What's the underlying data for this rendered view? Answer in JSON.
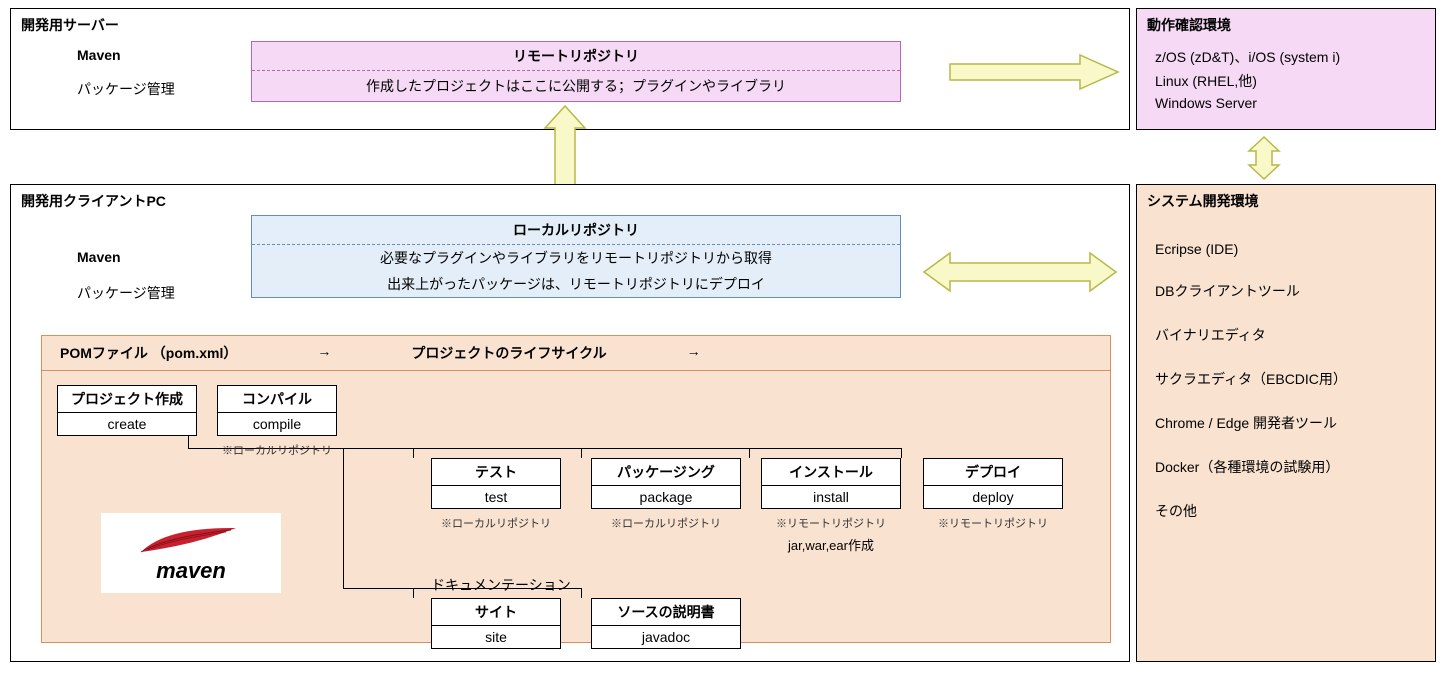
{
  "server": {
    "title": "開発用サーバー",
    "maven_label": "Maven",
    "pkg_label": "パッケージ管理",
    "remote_repo": {
      "title": "リモートリポジトリ",
      "desc": "作成したプロジェクトはここに公開する；プラグインやライブラリ"
    }
  },
  "runtime_env": {
    "title": "動作確認環境",
    "items": [
      "z/OS (zD&T)、i/OS (system i)",
      "Linux (RHEL,他)",
      "Windows Server"
    ]
  },
  "client": {
    "title": "開発用クライアントPC",
    "maven_label": "Maven",
    "pkg_label": "パッケージ管理",
    "local_repo": {
      "title": "ローカルリポジトリ",
      "desc1": "必要なプラグインやライブラリをリモートリポジトリから取得",
      "desc2": "出来上がったパッケージは、リモートリポジトリにデプロイ"
    },
    "pom": {
      "header_left": "POMファイル （pom.xml）",
      "header_arrow1": "→",
      "header_center": "プロジェクトのライフサイクル",
      "header_arrow2": "→"
    },
    "phases": {
      "create": {
        "title": "プロジェクト作成",
        "cmd": "create",
        "note": ""
      },
      "compile": {
        "title": "コンパイル",
        "cmd": "compile",
        "note": "※ローカルリポジトリ"
      },
      "test": {
        "title": "テスト",
        "cmd": "test",
        "note": "※ローカルリポジトリ"
      },
      "package": {
        "title": "パッケージング",
        "cmd": "package",
        "note": "※ローカルリポジトリ"
      },
      "install": {
        "title": "インストール",
        "cmd": "install",
        "note": "※リモートリポジトリ",
        "extra": "jar,war,ear作成"
      },
      "deploy": {
        "title": "デプロイ",
        "cmd": "deploy",
        "note": "※リモートリポジトリ"
      },
      "doc_label": "ドキュメンテーション",
      "site": {
        "title": "サイト",
        "cmd": "site"
      },
      "javadoc": {
        "title": "ソースの説明書",
        "cmd": "javadoc"
      }
    },
    "logo_text": "maven"
  },
  "dev_env": {
    "title": "システム開発環境",
    "items": [
      "Ecripse (IDE)",
      "DBクライアントツール",
      "バイナリエディタ",
      "サクラエディタ（EBCDIC用）",
      "Chrome / Edge 開発者ツール",
      "Docker（各種環境の試験用）",
      "その他"
    ]
  }
}
